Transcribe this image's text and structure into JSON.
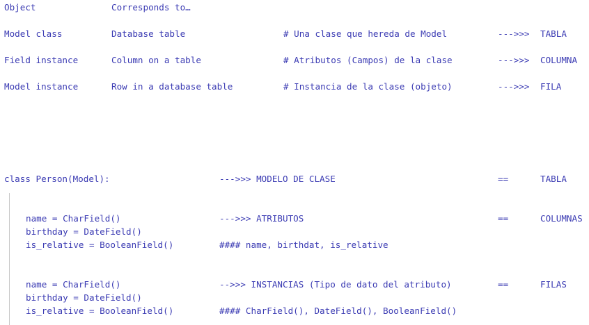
{
  "mapping_table": {
    "header": {
      "object": "Object",
      "corresponds": "Corresponds to…"
    },
    "rows": [
      {
        "object": "Model class",
        "corresponds": "Database table",
        "comment": "# Una clase que hereda de Model",
        "arrow": "--->>>",
        "es": "TABLA"
      },
      {
        "object": "Field instance",
        "corresponds": "Column on a table",
        "comment": "# Atributos (Campos) de la clase",
        "arrow": "--->>>",
        "es": "COLUMNA"
      },
      {
        "object": "Model instance",
        "corresponds": "Row in a database table",
        "comment": "# Instancia de la clase (objeto)",
        "arrow": "--->>>",
        "es": "FILA"
      }
    ]
  },
  "code": {
    "class_line": {
      "code": "class Person(Model):",
      "note": "--->>> MODELO DE CLASE",
      "eq": "==",
      "es": "TABLA"
    },
    "block1": {
      "lines": [
        "name = CharField()",
        "birthday = DateField()",
        "is_relative = BooleanField()"
      ],
      "note": "--->>> ATRIBUTOS",
      "eq": "==",
      "es": "COLUMNAS",
      "comment": "#### name, birthdat, is_relative"
    },
    "block2": {
      "lines": [
        "name = CharField()",
        "birthday = DateField()",
        "is_relative = BooleanField()"
      ],
      "note": "-->>> INSTANCIAS (Tipo de dato del atributo)",
      "eq": "==",
      "es": "FILAS",
      "comment": "#### CharField(), DateField(), BooleanField()"
    }
  }
}
